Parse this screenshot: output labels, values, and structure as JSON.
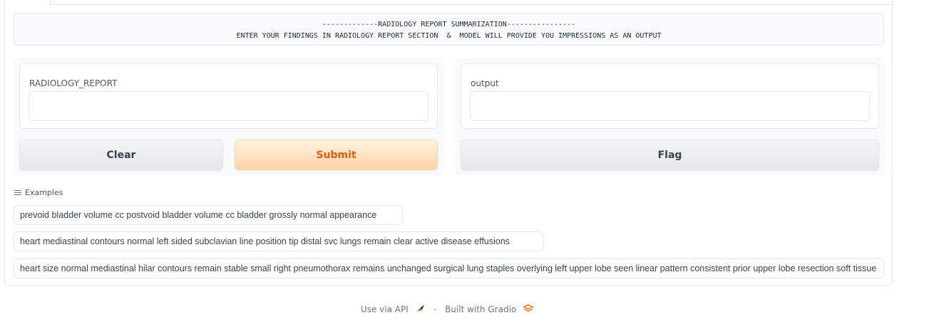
{
  "header": {
    "line1": "-------------RADIOLOGY REPORT SUMMARIZATION----------------",
    "line2": "ENTER YOUR FINDINGS IN RADIOLOGY REPORT SECTION  &  MODEL WILL PROVIDE YOU IMPRESSIONS AS AN OUTPUT"
  },
  "input_panel": {
    "label": "RADIOLOGY_REPORT",
    "value": "",
    "clear_label": "Clear",
    "submit_label": "Submit"
  },
  "output_panel": {
    "label": "output",
    "value": "",
    "flag_label": "Flag"
  },
  "examples": {
    "label": "Examples",
    "items": [
      "prevoid bladder volume cc postvoid bladder volume cc bladder grossly normal appearance",
      "heart mediastinal contours normal left sided subclavian line position tip distal svc lungs remain clear active disease effusions",
      "heart size normal mediastinal hilar contours remain stable small right pneumothorax remains unchanged surgical lung staples overlying left upper lobe seen linear pattern consistent prior upper lobe resection soft tissue"
    ]
  },
  "footer": {
    "api_label": "Use via API",
    "separator": "·",
    "built_label": "Built with Gradio"
  },
  "colors": {
    "accent": "#ea580c",
    "border": "#e5e7eb"
  }
}
